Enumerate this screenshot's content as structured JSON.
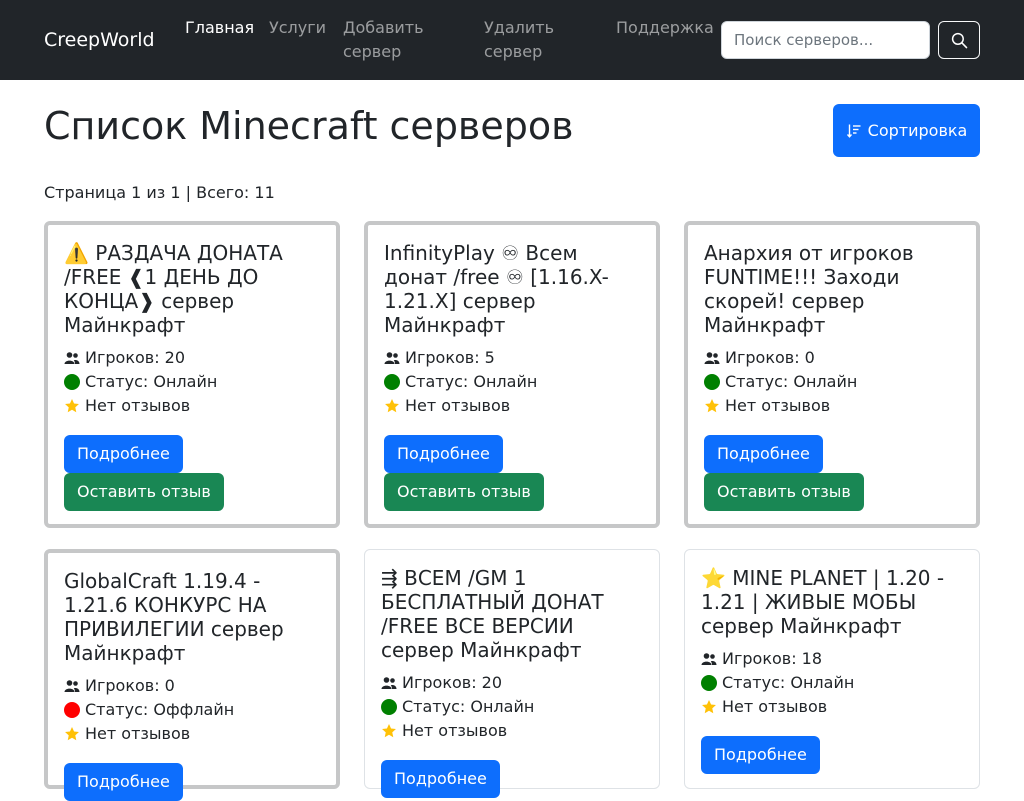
{
  "navbar": {
    "brand": "CreepWorld",
    "links": [
      {
        "label": "Главная"
      },
      {
        "label": "Услуги"
      },
      {
        "label": "Добавить сервер"
      },
      {
        "label": "Удалить сервер"
      },
      {
        "label": "Поддержка"
      }
    ],
    "search_placeholder": "Поиск серверов...",
    "search_icon": "search-icon"
  },
  "main": {
    "title": "Список Minecraft серверов",
    "sort_label": "Сортировка",
    "page_info": "Страница 1 из 1 | Всего: 11"
  },
  "labels": {
    "players_prefix": "Игроков:",
    "status_prefix": "Статус:",
    "details_button": "Подробнее",
    "review_button": "Оставить отзыв"
  },
  "colors": {
    "online": "#008000",
    "offline": "#ff0000",
    "star": "#ffc107",
    "primary": "#0d6efd",
    "success": "#198754"
  },
  "servers": [
    {
      "title": "⚠️ РАЗДАЧА ДОНАТА /FREE ❰1 ДЕНЬ ДО КОНЦА❱ сервер Майнкрафт",
      "players": "Игроков: 20",
      "status": "Статус: Онлайн",
      "reviews": "Нет отзывов",
      "online": true
    },
    {
      "title": "InfinityPlay ♾ Всем донат /free ♾ [1.16.X-1.21.X] сервер Майнкрафт",
      "players": "Игроков: 5",
      "status": "Статус: Онлайн",
      "reviews": "Нет отзывов",
      "online": true
    },
    {
      "title": "Анархия от игроков FUNTIME!!! Заходи скорей! сервер Майнкрафт",
      "players": "Игроков: 0",
      "status": "Статус: Онлайн",
      "reviews": "Нет отзывов",
      "online": true
    },
    {
      "title": "GlobalCraft 1.19.4 - 1.21.6 КОНКУРС НА ПРИВИЛЕГИИ сервер Майнкрафт",
      "players": "Игроков: 0",
      "status": "Статус: Оффлайн",
      "reviews": "Нет отзывов",
      "online": false
    },
    {
      "title": "⇶ ВСЕМ /GM 1 БЕСПЛАТНЫЙ ДОНАТ /FREE ВСЕ ВЕРСИИ сервер Майнкрафт",
      "players": "Игроков: 20",
      "status": "Статус: Онлайн",
      "reviews": "Нет отзывов",
      "online": true
    },
    {
      "title": "⭐ MINE PLANET | 1.20 - 1.21 | ЖИВЫЕ МОБЫ сервер Майнкрафт",
      "players": "Игроков: 18",
      "status": "Статус: Онлайн",
      "reviews": "Нет отзывов",
      "online": true
    }
  ]
}
